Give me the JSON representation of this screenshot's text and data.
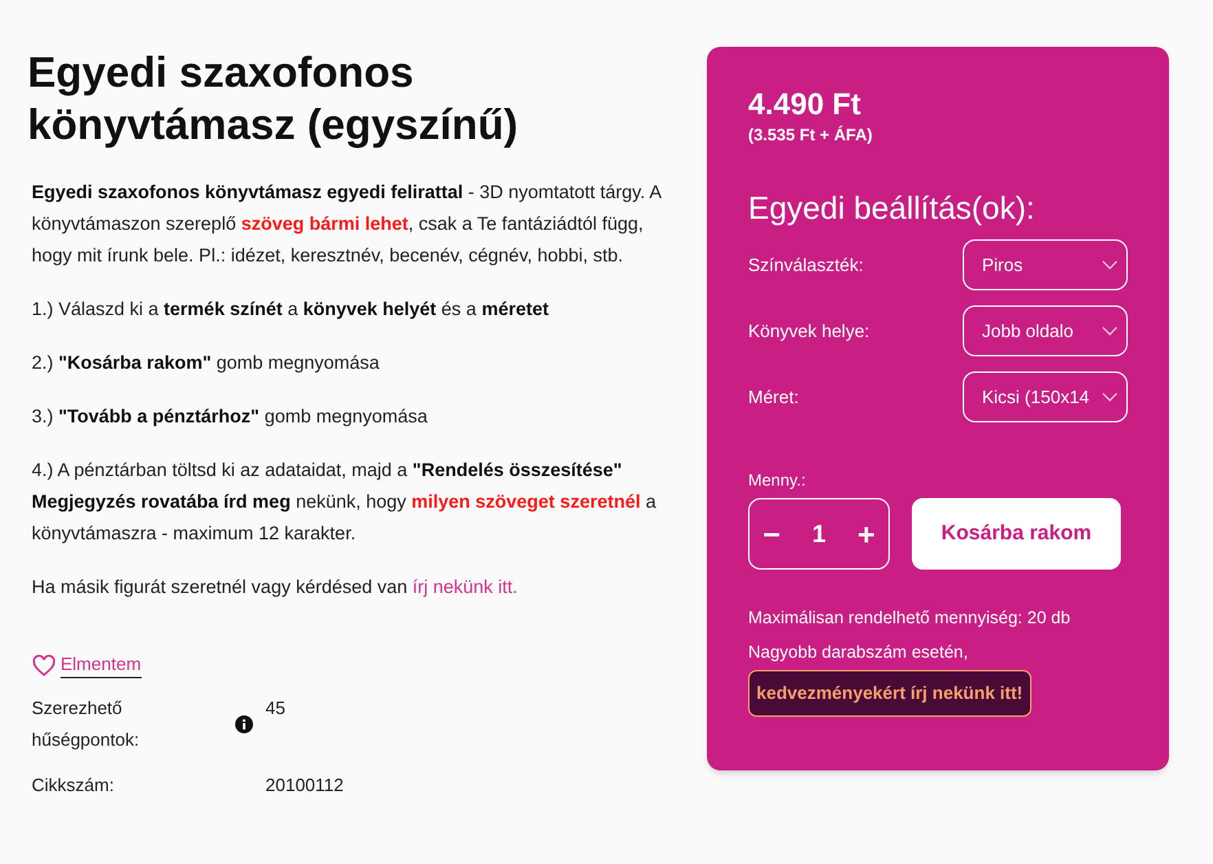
{
  "product": {
    "title": "Egyedi szaxofonos könyvtámasz (egyszínű)",
    "paragraphs": [
      [
        {
          "text": "Egyedi szaxofonos könyvtámasz egyedi felirattal",
          "kind": "bold"
        },
        {
          "text": " - 3D nyomtatott tárgy. A könyvtámaszon szereplő ",
          "kind": "plain"
        },
        {
          "text": "szöveg bármi lehet",
          "kind": "red"
        },
        {
          "text": ", csak a Te fantáziádtól függ, hogy mit írunk bele. Pl.: idézet, keresztnév, becenév, cégnév, hobbi, stb.",
          "kind": "plain"
        }
      ],
      [
        {
          "text": "1.) Válaszd ki a ",
          "kind": "plain"
        },
        {
          "text": "termék színét",
          "kind": "bold"
        },
        {
          "text": " a ",
          "kind": "plain"
        },
        {
          "text": "könyvek helyét",
          "kind": "bold"
        },
        {
          "text": " és a ",
          "kind": "plain"
        },
        {
          "text": "méretet",
          "kind": "bold"
        }
      ],
      [
        {
          "text": "2.) ",
          "kind": "plain"
        },
        {
          "text": "\"Kosárba rakom\"",
          "kind": "bold"
        },
        {
          "text": " gomb megnyomása",
          "kind": "plain"
        }
      ],
      [
        {
          "text": "3.) ",
          "kind": "plain"
        },
        {
          "text": "\"Tovább a pénztárhoz\"",
          "kind": "bold"
        },
        {
          "text": " gomb megnyomása",
          "kind": "plain"
        }
      ],
      [
        {
          "text": "4.) A pénztárban töltsd ki az adataidat, majd a ",
          "kind": "plain"
        },
        {
          "text": "\"Rendelés összesítése\" Megjegyzés rovatába írd meg",
          "kind": "bold"
        },
        {
          "text": " nekünk, hogy ",
          "kind": "plain"
        },
        {
          "text": "milyen szöveget szeretnél",
          "kind": "red"
        },
        {
          "text": " a könyvtámaszra - maximum 12 karakter.",
          "kind": "plain"
        }
      ],
      [
        {
          "text": "Ha másik figurát szeretnél vagy kérdésed van ",
          "kind": "plain"
        },
        {
          "text": "írj nekünk itt.",
          "kind": "link"
        }
      ]
    ],
    "save_link": "Elmentem",
    "details": [
      {
        "label": "Szerezhető hűségpontok:",
        "value": "45",
        "info": true
      },
      {
        "label": "Cikkszám:",
        "value": "20100112",
        "info": false
      }
    ]
  },
  "purchase": {
    "price": "4.490 Ft",
    "net_price": "(3.535 Ft + ÁFA)",
    "options_title": "Egyedi beállítás(ok):",
    "options": [
      {
        "label": "Színválaszték:",
        "value": "Piros"
      },
      {
        "label": "Könyvek helye:",
        "value": "Jobb oldalo"
      },
      {
        "label": "Méret:",
        "value": "Kicsi (150x14"
      }
    ],
    "quantity_label": "Menny.:",
    "decrement": "−",
    "quantity": "1",
    "increment": "+",
    "add_to_cart": "Kosárba rakom",
    "max_note": "Maximálisan rendelhető mennyiség: 20 db",
    "bulk_note": "Nagyobb darabszám esetén,",
    "discount_link": "kedvezményekért írj nekünk itt!"
  }
}
